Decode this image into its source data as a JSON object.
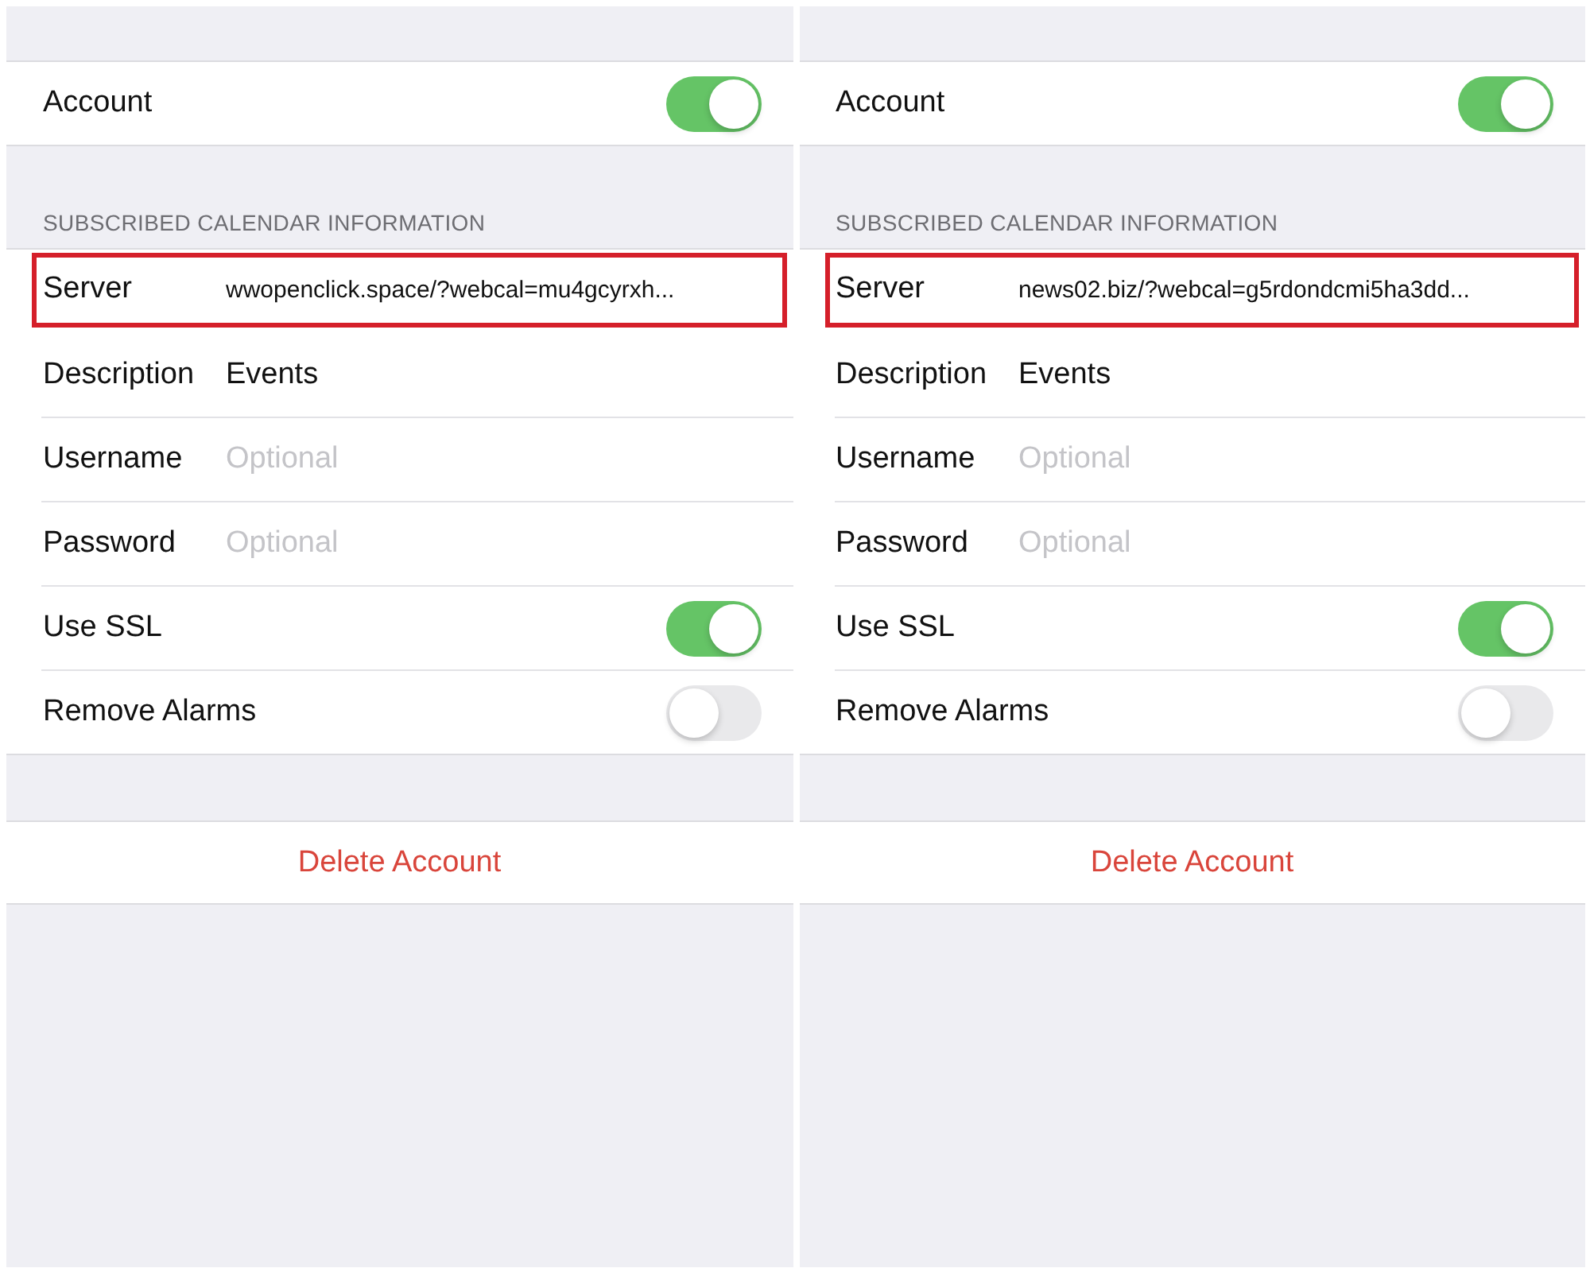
{
  "panels": [
    {
      "account": {
        "label": "Account",
        "on": true
      },
      "section_header": "SUBSCRIBED CALENDAR INFORMATION",
      "rows": [
        {
          "kind": "field",
          "label": "Server",
          "value": "wwopenclick.space/?webcal=mu4gcyrxh...",
          "highlighted": true
        },
        {
          "kind": "field",
          "label": "Description",
          "value": "Events",
          "highlighted": false
        },
        {
          "kind": "field",
          "label": "Username",
          "placeholder": "Optional",
          "highlighted": false
        },
        {
          "kind": "field",
          "label": "Password",
          "placeholder": "Optional",
          "highlighted": false
        },
        {
          "kind": "toggle",
          "label": "Use SSL",
          "on": true
        },
        {
          "kind": "toggle",
          "label": "Remove Alarms",
          "on": false
        }
      ],
      "delete_label": "Delete Account"
    },
    {
      "account": {
        "label": "Account",
        "on": true
      },
      "section_header": "SUBSCRIBED CALENDAR INFORMATION",
      "rows": [
        {
          "kind": "field",
          "label": "Server",
          "value": "news02.biz/?webcal=g5rdondcmi5ha3dd...",
          "highlighted": true
        },
        {
          "kind": "field",
          "label": "Description",
          "value": "Events",
          "highlighted": false
        },
        {
          "kind": "field",
          "label": "Username",
          "placeholder": "Optional",
          "highlighted": false
        },
        {
          "kind": "field",
          "label": "Password",
          "placeholder": "Optional",
          "highlighted": false
        },
        {
          "kind": "toggle",
          "label": "Use SSL",
          "on": true
        },
        {
          "kind": "toggle",
          "label": "Remove Alarms",
          "on": false
        }
      ],
      "delete_label": "Delete Account"
    }
  ]
}
